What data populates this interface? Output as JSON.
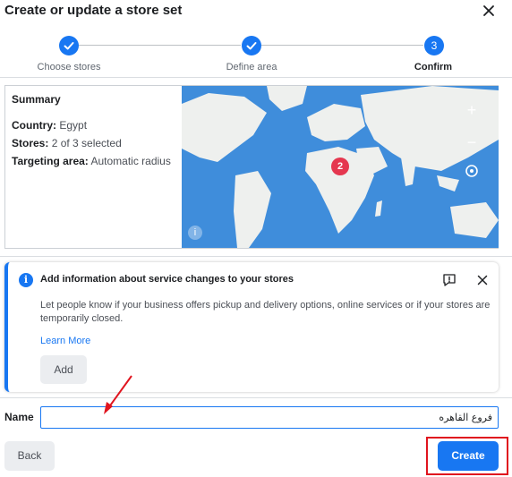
{
  "dialog": {
    "title": "Create or update a store set"
  },
  "stepper": {
    "steps": [
      {
        "label": "Choose stores",
        "state": "done"
      },
      {
        "label": "Define area",
        "state": "done"
      },
      {
        "label": "Confirm",
        "number": "3",
        "state": "current"
      }
    ]
  },
  "summary": {
    "heading": "Summary",
    "country_label": "Country:",
    "country_value": "Egypt",
    "stores_label": "Stores:",
    "stores_value": "2 of 3 selected",
    "area_label": "Targeting area:",
    "area_value": "Automatic radius"
  },
  "map": {
    "cluster_count": "2",
    "zoom_in": "+",
    "zoom_out": "−",
    "info": "i"
  },
  "info_card": {
    "title": "Add information about service changes to your stores",
    "body": "Let people know if your business offers pickup and delivery options, online services or if your stores are temporarily closed.",
    "link": "Learn More",
    "add_label": "Add",
    "icon_glyph": "i"
  },
  "name_field": {
    "label": "Name",
    "value": "فروع القاهره"
  },
  "footer": {
    "back_label": "Back",
    "create_label": "Create"
  },
  "colors": {
    "accent": "#1877f2",
    "annotation": "#e0141e",
    "map_water": "#3f8ddb",
    "pin": "#e5374f"
  }
}
